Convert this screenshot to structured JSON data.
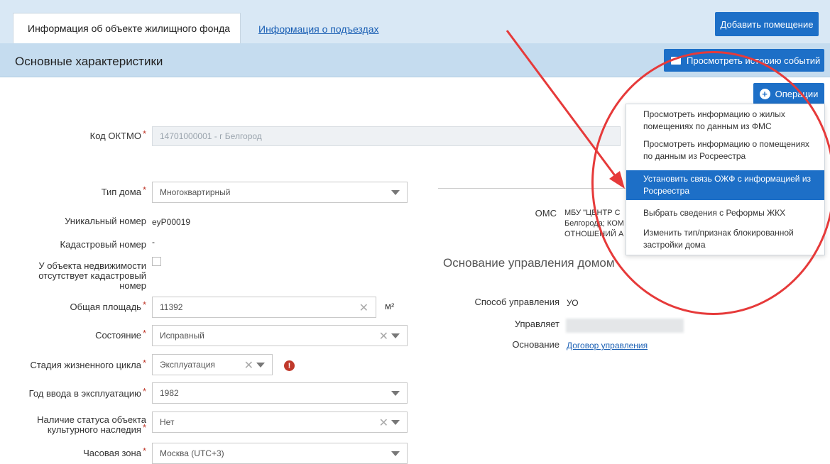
{
  "tabs": {
    "active": "Информация об объекте жилищного фонда",
    "link": "Информация о подъездах"
  },
  "buttons": {
    "add_room": "Добавить помещение",
    "history": "Просмотреть историю событий",
    "operations": "Операции"
  },
  "section_title": "Основные характеристики",
  "operations_menu": [
    "Просмотреть информацию о жилых помещениях по данным из ФМС",
    "Просмотреть информацию о помещениях по данным из Росреестра",
    "Установить связь ОЖФ с информацией из Росреестра",
    "Выбрать сведения с Реформы ЖКХ",
    "Изменить тип/признак блокированной застройки дома"
  ],
  "form": {
    "oktmo_label": "Код ОКТМО",
    "oktmo_value": "14701000001 - г Белгород",
    "house_type_label": "Тип дома",
    "house_type_value": "Многоквартирный",
    "unique_label": "Уникальный номер",
    "unique_value": "eyP00019",
    "cadastral_label": "Кадастровый номер",
    "cadastral_value": "-",
    "no_cadastral_label": "У объекта недвижимости отсутствует кадастровый номер",
    "area_label": "Общая площадь",
    "area_value": "11392",
    "area_unit": "м²",
    "state_label": "Состояние",
    "state_value": "Исправный",
    "stage_label": "Стадия жизненного цикла",
    "stage_value": "Эксплуатация",
    "year_label": "Год ввода в эксплуатацию",
    "year_value": "1982",
    "heritage_label": "Наличие статуса объекта культурного наследия",
    "heritage_value": "Нет",
    "tz_label": "Часовая зона",
    "tz_value": "Москва (UTC+3)"
  },
  "right": {
    "oms_label": "ОМС",
    "oms_value": "МБУ \"ЦЕНТР С Белгорода; КОМ ОТНОШЕНИЙ А",
    "mgmt_title": "Основание управления домом",
    "method_label": "Способ управления",
    "method_value": "УО",
    "manages_label": "Управляет",
    "basis_label": "Основание",
    "basis_value": "Договор управления"
  },
  "colors": {
    "accent": "#1d6fc7",
    "annotation": "#e63a3a",
    "required": "#c0392b",
    "warning": "#c0392b"
  }
}
